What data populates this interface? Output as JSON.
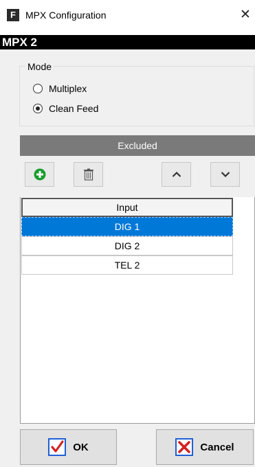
{
  "window": {
    "app_icon_letter": "F",
    "title": "MPX Configuration",
    "close_glyph": "✕"
  },
  "header": {
    "title": "MPX 2"
  },
  "mode": {
    "legend": "Mode",
    "options": [
      {
        "label": "Multiplex",
        "selected": false
      },
      {
        "label": "Clean Feed",
        "selected": true
      }
    ]
  },
  "panel": {
    "title": "Excluded",
    "toolbar": {
      "add_icon": "plus-circle-icon",
      "delete_icon": "trash-icon",
      "up_icon": "chevron-up-icon",
      "down_icon": "chevron-down-icon"
    },
    "table": {
      "column_header": "Input",
      "rows": [
        {
          "value": "DIG 1",
          "selected": true
        },
        {
          "value": "DIG 2",
          "selected": false
        },
        {
          "value": "TEL 2",
          "selected": false
        }
      ]
    }
  },
  "buttons": {
    "ok_label": "OK",
    "cancel_label": "Cancel"
  },
  "colors": {
    "header_bar": "#000000",
    "panel_header": "#7a7a7a",
    "selected_row": "#0078d7",
    "add_icon": "#1a9c2e",
    "ok_icon": "#1f5fd6",
    "cancel_icon": "#d42020"
  }
}
